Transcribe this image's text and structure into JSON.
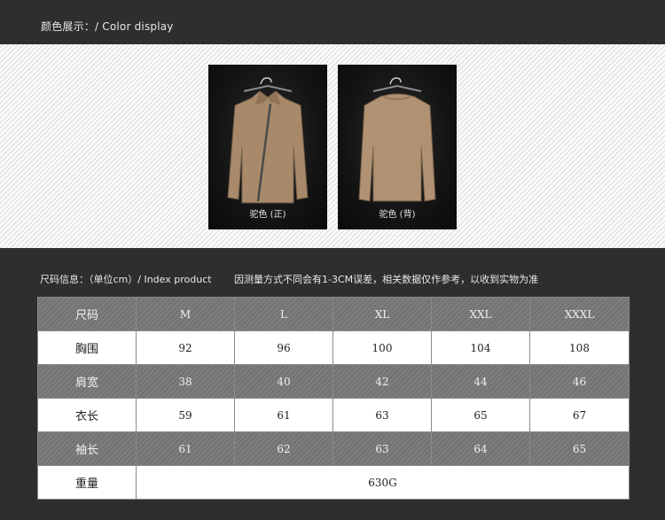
{
  "header": {
    "title": "颜色展示：/ Color display"
  },
  "photos": [
    {
      "caption": "驼色 (正)",
      "view": "front",
      "color": "#a88a6a"
    },
    {
      "caption": "驼色 (背)",
      "view": "back",
      "color": "#b09272"
    }
  ],
  "size_section": {
    "title": "尺码信息：（单位cm）/ Index product",
    "note": "因测量方式不同会有1-3CM误差，相关数据仅作参考，以收到实物为准"
  },
  "table": {
    "header_label": "尺码",
    "sizes": [
      "M",
      "L",
      "XL",
      "XXL",
      "XXXL"
    ],
    "rows": [
      {
        "label": "胸围",
        "values": [
          "92",
          "96",
          "100",
          "104",
          "108"
        ]
      },
      {
        "label": "肩宽",
        "values": [
          "38",
          "40",
          "42",
          "44",
          "46"
        ]
      },
      {
        "label": "衣长",
        "values": [
          "59",
          "61",
          "63",
          "65",
          "67"
        ]
      },
      {
        "label": "袖长",
        "values": [
          "61",
          "62",
          "63",
          "64",
          "65"
        ]
      }
    ],
    "weight_label": "重量",
    "weight_value": "630G"
  }
}
